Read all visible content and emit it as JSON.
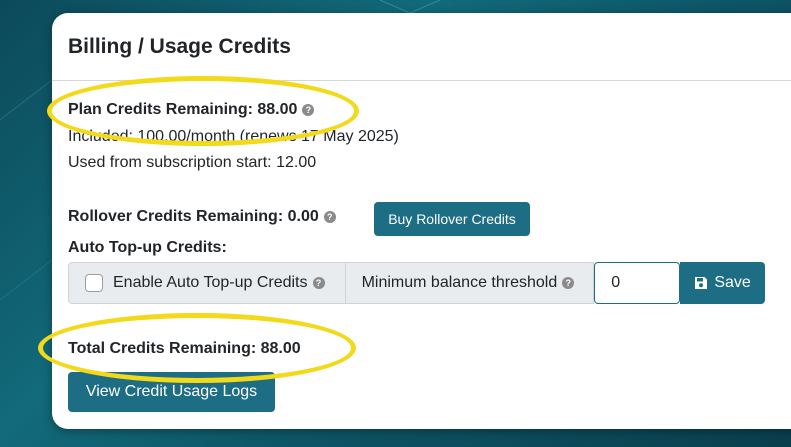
{
  "header": {
    "title": "Billing / Usage Credits"
  },
  "plan": {
    "remaining_label": "Plan Credits Remaining: 88.00",
    "included": "Included: 100.00/month (renews 17 May 2025)",
    "used": "Used from subscription start: 12.00"
  },
  "rollover": {
    "remaining_label": "Rollover Credits Remaining: 0.00",
    "buy_button": "Buy Rollover Credits"
  },
  "auto_topup": {
    "heading": "Auto Top-up Credits:",
    "enable_label": "Enable Auto Top-up Credits",
    "threshold_label": "Minimum balance threshold",
    "threshold_value": "0",
    "save_button": "Save"
  },
  "total": {
    "label": "Total Credits Remaining: 88.00"
  },
  "logs_button": "View Credit Usage Logs",
  "help_glyph": "?",
  "colors": {
    "accent": "#1d6d84",
    "highlight": "#f2d91a"
  }
}
